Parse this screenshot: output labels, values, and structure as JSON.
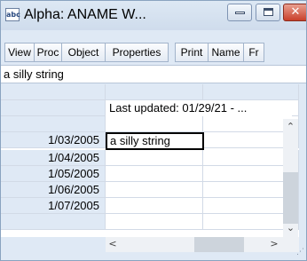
{
  "window": {
    "icon_label": "abc",
    "title": "Alpha: ANAME  W...",
    "close_glyph": "✕"
  },
  "toolbar": {
    "buttons": [
      "View",
      "Proc",
      "Object",
      "Properties",
      "Print",
      "Name",
      "Fr"
    ]
  },
  "edit_line": {
    "value": "a silly string"
  },
  "grid": {
    "header_text": "Last updated: 01/29/21 - ...",
    "rows": [
      {
        "label": "1/03/2005",
        "value": "a silly string"
      },
      {
        "label": "1/04/2005",
        "value": ""
      },
      {
        "label": "1/05/2005",
        "value": ""
      },
      {
        "label": "1/06/2005",
        "value": ""
      },
      {
        "label": "1/07/2005",
        "value": ""
      }
    ]
  },
  "scrollbars": {
    "up": "⌃",
    "down": "⌄",
    "left": "<",
    "right": ">"
  },
  "resize_grip": "⋰"
}
